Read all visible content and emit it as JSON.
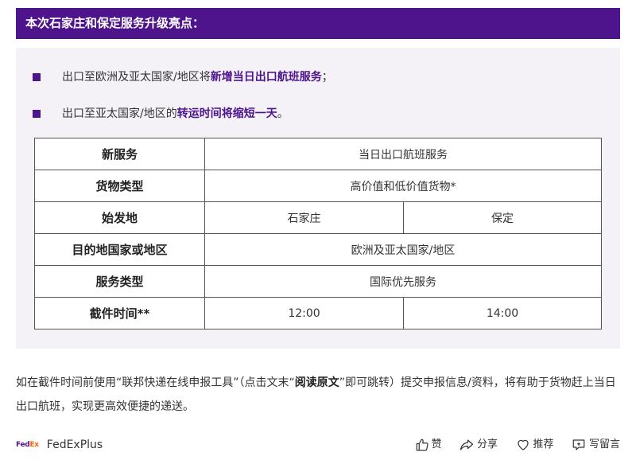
{
  "header": {
    "title": "本次石家庄和保定服务升级亮点："
  },
  "bullets": [
    {
      "prefix": "出口至欧洲及亚太国家/地区将",
      "highlight": "新增当日出口航班服务",
      "suffix": "；"
    },
    {
      "prefix": "出口至亚太国家/地区的",
      "highlight": "转运时间将缩短一天",
      "suffix": "。"
    }
  ],
  "table": {
    "rows": [
      {
        "label": "新服务",
        "value": "当日出口航班服务"
      },
      {
        "label": "货物类型",
        "value": "高价值和低价值货物*"
      },
      {
        "label": "始发地",
        "values": [
          "石家庄",
          "保定"
        ]
      },
      {
        "label": "目的地国家或地区",
        "value": "欧洲及亚太国家/地区"
      },
      {
        "label": "服务类型",
        "value": "国际优先服务"
      },
      {
        "label": "截件时间**",
        "values": [
          "12:00",
          "14:00"
        ]
      }
    ]
  },
  "paragraph": {
    "part1": "如在截件时间前使用“联邦快递在线申报工具”（点击文末“",
    "bold": "阅读原文",
    "part2": "”即可跳转）提交申报信息/资料，将有助于货物赶上当日出口航班，实现更高效便捷的递送。"
  },
  "footer": {
    "logo_fed": "Fed",
    "logo_ex": "Ex",
    "account_name": "FedExPlus",
    "like_label": "赞",
    "share_label": "分享",
    "recommend_label": "推荐",
    "comment_label": "写留言"
  },
  "colors": {
    "brand_purple": "#4d148c",
    "brand_orange": "#ff6200",
    "panel_bg": "#f4f2f6"
  }
}
